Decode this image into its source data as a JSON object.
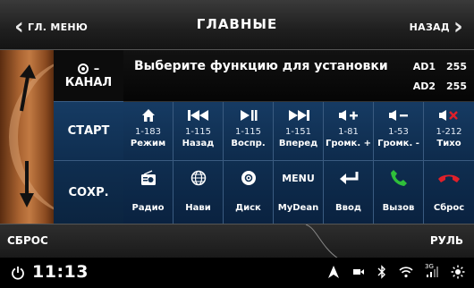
{
  "header": {
    "back_menu": "ГЛ. МЕНЮ",
    "title": "ГЛАВНЫЕ",
    "back": "НАЗАД"
  },
  "left": {
    "channel": "КАНАЛ",
    "channel_symbol": "–",
    "start": "СТАРТ",
    "save": "СОХР."
  },
  "info": {
    "prompt": "Выберите функцию для установки",
    "ad1_label": "AD1",
    "ad1_value": "255",
    "ad2_label": "AD2",
    "ad2_value": "255"
  },
  "functions_row1": [
    {
      "icon": "home-icon",
      "code": "1-183",
      "label": "Режим"
    },
    {
      "icon": "previous-track-icon",
      "code": "1-115",
      "label": "Назад"
    },
    {
      "icon": "play-pause-icon",
      "code": "1-115",
      "label": "Воспр."
    },
    {
      "icon": "next-track-icon",
      "code": "1-151",
      "label": "Вперед"
    },
    {
      "icon": "volume-up-icon",
      "code": "1-81",
      "label": "Громк. +"
    },
    {
      "icon": "volume-down-icon",
      "code": "1-53",
      "label": "Громк. -"
    },
    {
      "icon": "mute-icon",
      "code": "1-212",
      "label": "Тихо"
    }
  ],
  "functions_row2": [
    {
      "icon": "radio-icon",
      "label": "Радио"
    },
    {
      "icon": "globe-icon",
      "label": "Нави"
    },
    {
      "icon": "disc-icon",
      "label": "Диск"
    },
    {
      "icon_text": "MENU",
      "label": "MyDean"
    },
    {
      "icon": "enter-icon",
      "label": "Ввод"
    },
    {
      "icon": "call-icon",
      "label": "Вызов"
    },
    {
      "icon": "hangup-icon",
      "label": "Сброс"
    }
  ],
  "bottom": {
    "reset": "СБРОС",
    "wheel": "РУЛЬ"
  },
  "status": {
    "time": "11:13",
    "signal_label": "3G"
  },
  "colors": {
    "button_blue": "#163b63",
    "call_green": "#2fbf3a",
    "hangup_red": "#e0202a",
    "mute_red": "#e0202a",
    "steer_brown": "#a86230"
  }
}
